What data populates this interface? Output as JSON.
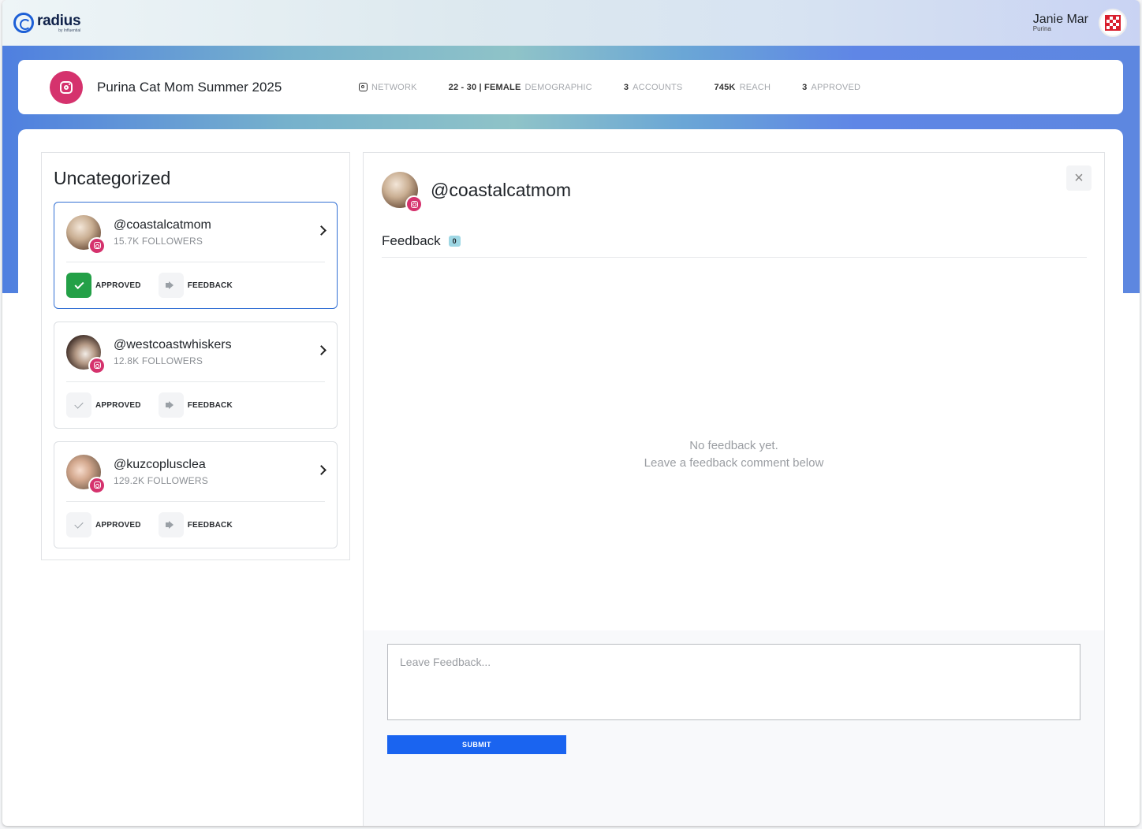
{
  "brand": {
    "name": "radius",
    "subtitle": "by Influential"
  },
  "user": {
    "name": "Janie Mar",
    "org": "Purina"
  },
  "campaign": {
    "title": "Purina Cat Mom Summer 2025",
    "stats": {
      "network_label": "NETWORK",
      "demographic_value": "22 - 30 | FEMALE",
      "demographic_label": "DEMOGRAPHIC",
      "accounts_value": "3",
      "accounts_label": "ACCOUNTS",
      "reach_value": "745K",
      "reach_label": "REACH",
      "approved_value": "3",
      "approved_label": "APPROVED"
    }
  },
  "left": {
    "title": "Uncategorized",
    "approved_label": "APPROVED",
    "feedback_label": "FEEDBACK",
    "accounts": [
      {
        "handle": "@coastalcatmom",
        "followers": "15.7K FOLLOWERS",
        "approved": true
      },
      {
        "handle": "@westcoastwhiskers",
        "followers": "12.8K FOLLOWERS",
        "approved": false
      },
      {
        "handle": "@kuzcoplusclea",
        "followers": "129.2K FOLLOWERS",
        "approved": false
      }
    ]
  },
  "detail": {
    "handle": "@coastalcatmom",
    "close_icon": "×",
    "feedback_title": "Feedback",
    "feedback_count": "0",
    "empty_line1": "No feedback yet.",
    "empty_line2": "Leave a feedback comment below",
    "input_placeholder": "Leave Feedback...",
    "submit_label": "SUBMIT"
  },
  "colors": {
    "accent": "#1a64f0",
    "instagram": "#d5326d",
    "approved": "#23a047",
    "selected_border": "#3471d4"
  }
}
